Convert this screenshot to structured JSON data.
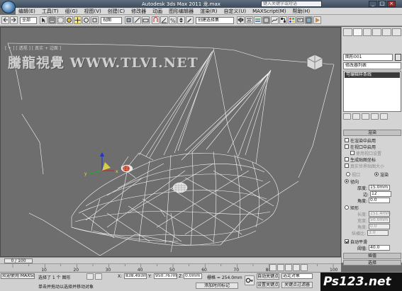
{
  "window": {
    "title": "Autodesk 3ds Max  2011      龙.max",
    "search_placeholder": "键入关键字或短语"
  },
  "menu": [
    "编辑(E)",
    "工具(T)",
    "组(G)",
    "视图(V)",
    "创建(C)",
    "修改器",
    "动画",
    "图形编辑器",
    "渲染(R)",
    "自定义(U)",
    "MAXScript(M)",
    "帮助(H)"
  ],
  "toolbar": {
    "selection_filter": "全部",
    "coord_system": "视图",
    "named_selection_placeholder": "创建选择集"
  },
  "viewport": {
    "label": "[ + ] [ 透视 ] [ 真实 + 边面 ]",
    "watermark": "騰龍視覺 WWW.TLVI.NET"
  },
  "command_panel": {
    "object_name": "图形001",
    "modifier_list": "修改器列表",
    "stack_item": "可编辑样条线",
    "rollout_title": "渲染",
    "options": [
      {
        "label": "在渲染中启用",
        "checked": false,
        "enabled": true
      },
      {
        "label": "在视口中启用",
        "checked": false,
        "enabled": true
      },
      {
        "label": "使用视口设置",
        "checked": false,
        "enabled": false
      },
      {
        "label": "生成贴图坐标",
        "checked": false,
        "enabled": true
      },
      {
        "label": "真实世界贴图大小",
        "checked": false,
        "enabled": false
      }
    ],
    "mode_viewport": "视口",
    "mode_render": "渲染",
    "radial": {
      "label": "径向",
      "thickness_label": "厚度:",
      "thickness": "15.0mm",
      "sides_label": "边:",
      "sides": "12",
      "angle_label": "角度:",
      "angle": "0.0"
    },
    "rectangular": {
      "label": "矩形",
      "length_label": "长度:",
      "length": "151.4mm",
      "width_label": "宽度:",
      "width": "50.0mm",
      "angle_label": "角度:",
      "angle": "0.0",
      "aspect_label": "纵横比:",
      "aspect": "3.0"
    },
    "auto_smooth_label": "自动平滑",
    "threshold_label": "阈值:",
    "threshold": "40.0",
    "rollout_interp": "插值",
    "rollout_select": "选择"
  },
  "timeline": {
    "frame_display": "0 / 100",
    "ticks": [
      "10",
      "20",
      "30",
      "40",
      "50",
      "60",
      "70",
      "80",
      "90",
      "100"
    ]
  },
  "status": {
    "selection": "选择了 1 个 图形",
    "x_label": "X:",
    "x": "838.493m",
    "y_label": "Y:",
    "y": "950.767m",
    "z_label": "Z:",
    "z": "0.0mm",
    "grid": "栅格 = 254.0mm",
    "auto_key": "自动关键点",
    "key_mode": "选定对象",
    "set_key": "设置关键点",
    "key_filters": "关键点过滤器",
    "welcome": "欢迎使用 MAXSc",
    "prompt": "单击并拖动以选择并移动对象",
    "add_time_tag": "添加时间标记"
  },
  "logo": "Ps123.net"
}
